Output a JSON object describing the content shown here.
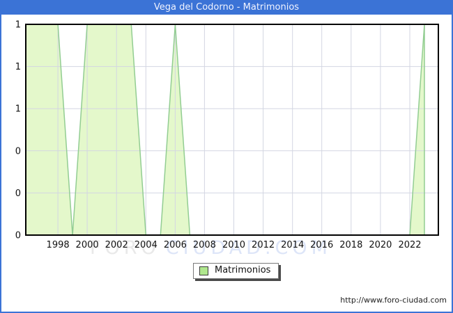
{
  "window": {
    "title": "Vega del Codorno - Matrimonios"
  },
  "chart_data": {
    "type": "area",
    "title": "Vega del Codorno - Matrimonios",
    "x": [
      1996,
      1997,
      1998,
      1999,
      2000,
      2001,
      2002,
      2003,
      2004,
      2005,
      2006,
      2007,
      2008,
      2009,
      2010,
      2011,
      2012,
      2013,
      2014,
      2015,
      2016,
      2017,
      2018,
      2019,
      2020,
      2021,
      2022,
      2023
    ],
    "series": [
      {
        "name": "Matrimonios",
        "values": [
          1,
          1,
          1,
          0,
          1,
          1,
          1,
          1,
          0,
          0,
          1,
          0,
          0,
          0,
          0,
          0,
          0,
          0,
          0,
          0,
          0,
          0,
          0,
          0,
          0,
          0,
          0,
          1
        ]
      }
    ],
    "xlabel": "",
    "ylabel": "",
    "ylim": [
      0,
      1
    ],
    "grid": true,
    "xticks": [
      1998,
      2000,
      2002,
      2004,
      2006,
      2008,
      2010,
      2012,
      2014,
      2016,
      2018,
      2020,
      2022
    ],
    "yticks": [
      {
        "label": "1",
        "value": 1.0
      },
      {
        "label": "1",
        "value": 0.8
      },
      {
        "label": "1",
        "value": 0.6
      },
      {
        "label": "0",
        "value": 0.4
      },
      {
        "label": "0",
        "value": 0.2
      },
      {
        "label": "0",
        "value": 0.0
      }
    ],
    "legend_position": "bottom-center"
  },
  "legend": {
    "label": "Matrimonios"
  },
  "watermark": {
    "left": "FORO",
    "right": "CIUDAD.COM"
  },
  "footer": {
    "url": "http://www.foro-ciudad.com"
  },
  "colors": {
    "titlebar": "#3b73d6",
    "border": "#3b73d6",
    "title_text": "#f0f3ff",
    "area_fill": "#e4f8cb",
    "area_line": "#92cd92",
    "legend_swatch": "#b0e78e",
    "grid": "#d3d6e2",
    "frame": "#000000",
    "tick_text": "#111111",
    "watermark_left": "#e9e9e9",
    "watermark_right": "#dde5f8"
  }
}
